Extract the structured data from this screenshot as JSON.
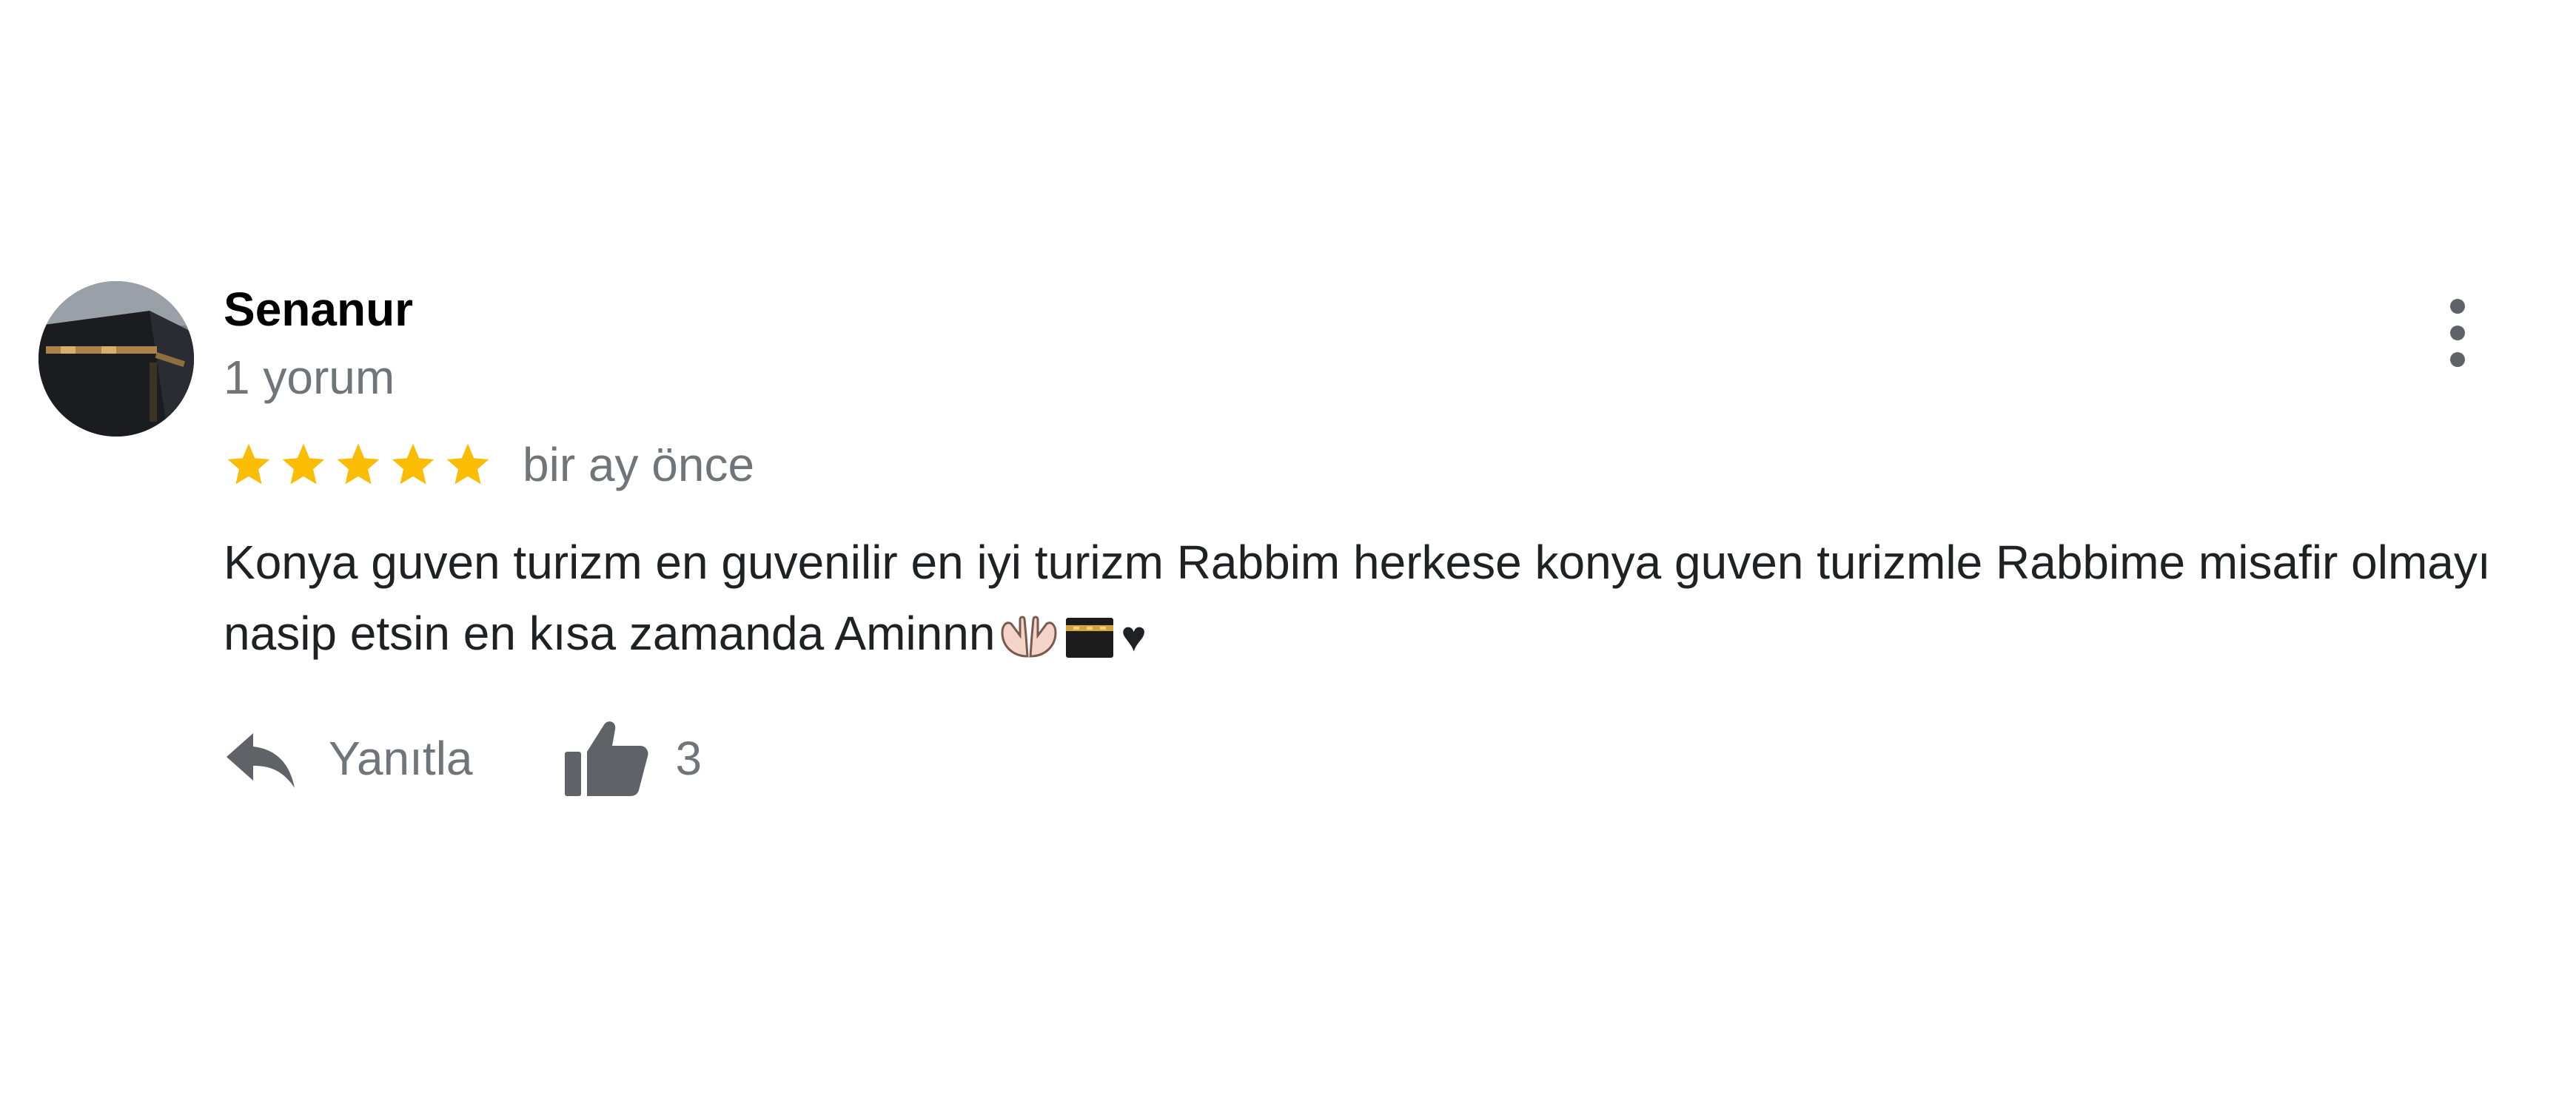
{
  "review": {
    "author_name": "Senanur",
    "review_count": "1 yorum",
    "rating": 5,
    "rating_max": 5,
    "date": "bir ay önce",
    "text_main": "Konya guven turizm en guvenilir en iyi turizm Rabbim herkese konya guven turizmle Rabbime misafir olmayı nasip etsin en kısa zamanda Aminnn",
    "text_heart": "♥",
    "emojis": [
      "open-hands-icon",
      "kaaba-icon",
      "heart-icon"
    ],
    "avatar": "kaaba-photo-avatar",
    "menu_icon": "more-vert-icon"
  },
  "actions": {
    "reply_label": "Yanıtla",
    "reply_icon": "reply-arrow-icon",
    "like_count": "3",
    "like_icon": "thumbs-up-icon"
  },
  "colors": {
    "star": "#fbbc04",
    "secondary_text": "#70757a",
    "primary_text": "#202124",
    "icon": "#5f6368"
  }
}
